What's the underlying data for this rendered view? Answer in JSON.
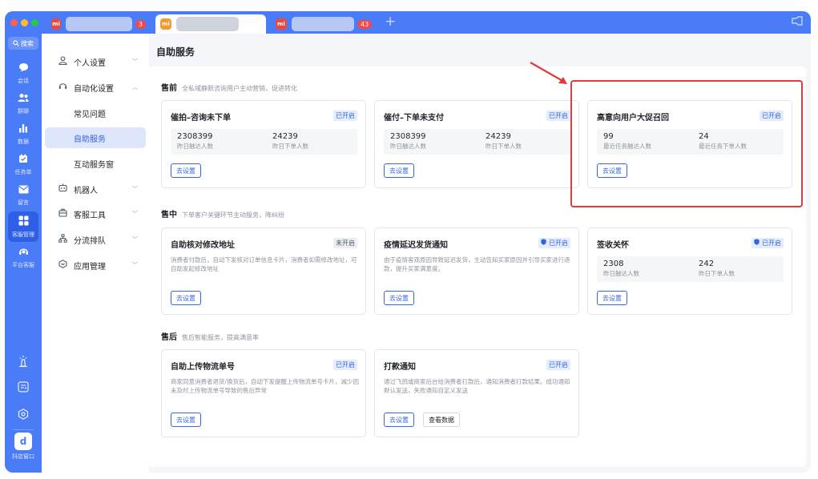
{
  "tabs": [
    {
      "logo": "mi",
      "badge": "3"
    },
    {
      "logo": "mi",
      "badge": ""
    },
    {
      "logo": "mi",
      "badge": "43"
    }
  ],
  "tab_add_glyph": "+",
  "nav": {
    "search": "搜索",
    "items": [
      {
        "label": "会话",
        "icon": "chat-icon"
      },
      {
        "label": "群聊",
        "icon": "group-icon"
      },
      {
        "label": "数据",
        "icon": "chart-icon"
      },
      {
        "label": "任务单",
        "icon": "task-icon"
      },
      {
        "label": "留言",
        "icon": "mail-icon"
      },
      {
        "label": "客服管理",
        "icon": "grid-icon"
      },
      {
        "label": "平台客服",
        "icon": "headset-icon"
      }
    ],
    "shop_window": "抖店窗口",
    "shop_logo": "d"
  },
  "submenu": {
    "items": [
      {
        "label": "个人设置",
        "icon": "person-icon",
        "chevron": "﹀"
      },
      {
        "label": "自动化设置",
        "icon": "headset-icon",
        "chevron": "︿"
      },
      {
        "label": "常见问题"
      },
      {
        "label": "自助服务"
      },
      {
        "label": "互动服务窗"
      },
      {
        "label": "机器人",
        "icon": "robot-icon",
        "chevron": "﹀"
      },
      {
        "label": "客服工具",
        "icon": "toolbox-icon",
        "chevron": "﹀"
      },
      {
        "label": "分流排队",
        "icon": "flow-icon",
        "chevron": "﹀"
      },
      {
        "label": "应用管理",
        "icon": "app-icon",
        "chevron": "﹀"
      }
    ]
  },
  "main": {
    "title": "自助服务",
    "sections": [
      {
        "title": "售前",
        "desc": "全私域静默咨询用户主动营销，促进转化"
      },
      {
        "title": "售中",
        "desc": "下单客户关键环节主动服务，降纠纷"
      },
      {
        "title": "售后",
        "desc": "售后智能服务，提高满意率"
      }
    ],
    "cards": {
      "c1": {
        "title": "催拍–咨询未下单",
        "status": "已开启",
        "stat1": "2308399",
        "stat1_label": "昨日触达人数",
        "stat2": "24239",
        "stat2_label": "昨日下单人数",
        "btn": "去设置"
      },
      "c2": {
        "title": "催付–下单未支付",
        "status": "已开启",
        "stat1": "2308399",
        "stat1_label": "昨日触达人数",
        "stat2": "24239",
        "stat2_label": "昨日下单人数",
        "btn": "去设置"
      },
      "c3": {
        "title": "高意向用户大促召回",
        "status": "已开启",
        "stat1": "99",
        "stat1_label": "最近任务触达人数",
        "stat2": "24",
        "stat2_label": "最近任务下单人数",
        "btn": "去设置"
      },
      "c4": {
        "title": "自助核对修改地址",
        "status": "未开启",
        "desc": "消费者付款后，自动下发核对订单信息卡片，消费者如需修改地址，可自助发起修改地址",
        "btn": "去设置"
      },
      "c5": {
        "title": "疫情延迟发货通知",
        "status": "已开启",
        "desc": "由于疫情客观原因导致延迟发货，主动告知买家原因并引导买家进行退款，提升买家满意度。",
        "btn": "去设置"
      },
      "c6": {
        "title": "签收关怀",
        "status": "已开启",
        "stat1": "2308",
        "stat1_label": "昨日触达人数",
        "stat2": "242",
        "stat2_label": "昨日下单人数",
        "btn": "去设置"
      },
      "c7": {
        "title": "自助上传物流单号",
        "status": "已开启",
        "desc": "商家同意消费者退货/换货后，自动下发提醒上传物流单号卡片，减少因未及时上传物流单号导致的售后异常",
        "btn": "去设置"
      },
      "c8": {
        "title": "打款通知",
        "status": "已开启",
        "desc": "通过飞鸽或商家后台给消费者打款后，通知消费者打款结果。成功通知默认发送，失败通知自定义发送",
        "btn": "去设置",
        "btn2": "查看数据"
      }
    }
  },
  "colors": {
    "accent": "#4a7cf7",
    "link": "#3366e0",
    "highlight": "#e03a3a"
  }
}
